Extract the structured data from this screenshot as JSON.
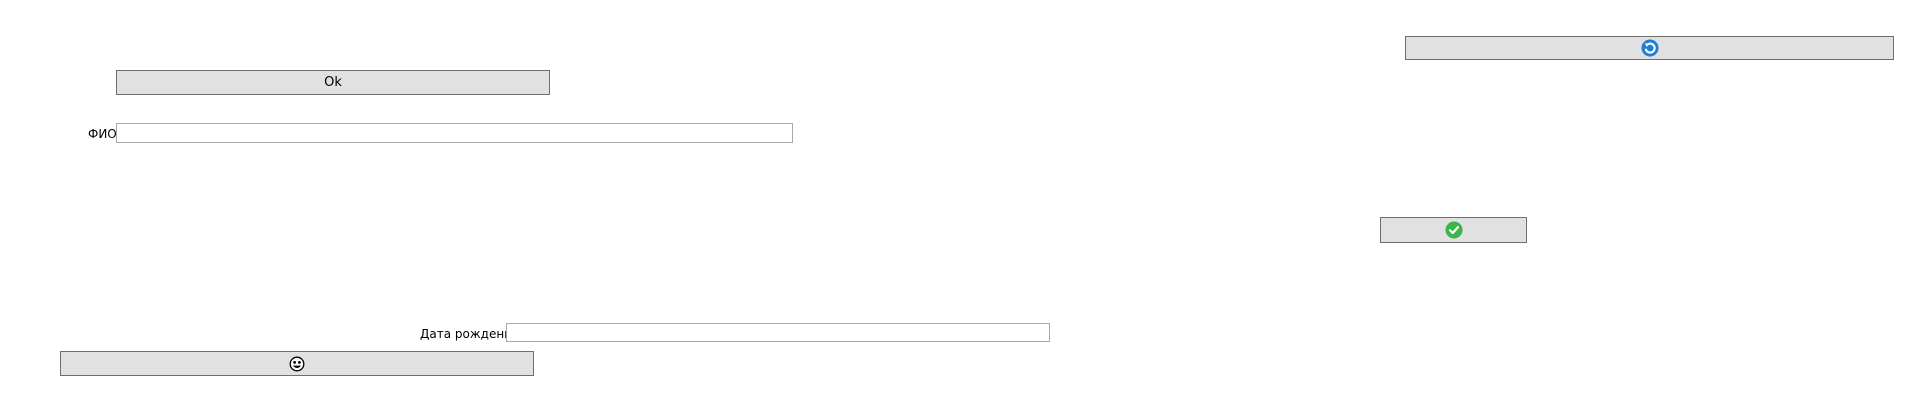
{
  "form": {
    "ok_button": {
      "label": "Ok"
    },
    "fio": {
      "label": "ФИО",
      "value": ""
    },
    "birth_date": {
      "label": "Дата рождения",
      "value": ""
    },
    "refresh_button": {
      "icon": "refresh-icon",
      "color": "#1e7fd3"
    },
    "confirm_button": {
      "icon": "check-circle-icon",
      "color": "#3bb54a"
    },
    "emoji_button": {
      "icon": "face-icon"
    }
  }
}
